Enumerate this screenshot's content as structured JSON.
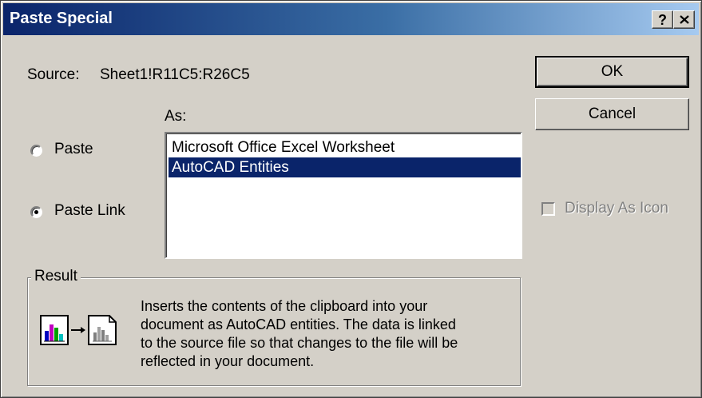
{
  "window": {
    "title": "Paste Special",
    "help_button": "?",
    "close_button": "✕"
  },
  "source": {
    "label": "Source:",
    "value": "Sheet1!R11C5:R26C5"
  },
  "as_label": "As:",
  "options": {
    "paste_label": "Paste",
    "paste_link_label": "Paste Link",
    "selected": "Paste Link"
  },
  "list": {
    "items": [
      "Microsoft Office Excel Worksheet",
      "AutoCAD Entities"
    ],
    "selected_index": 1
  },
  "buttons": {
    "ok": "OK",
    "cancel": "Cancel"
  },
  "display_as_icon": {
    "label": "Display As Icon",
    "checked": false,
    "enabled": false
  },
  "result": {
    "label": "Result",
    "lines": [
      "Inserts the contents of the clipboard into your",
      "document as AutoCAD entities.  The data is linked",
      "to the source file so that changes to the file will be",
      "reflected in your document."
    ],
    "icon": "paste-link-chart-icon"
  },
  "colors": {
    "face": "#d4d0c8",
    "title_start": "#0a246a",
    "title_end": "#a6caf0",
    "selection": "#0a246a"
  }
}
